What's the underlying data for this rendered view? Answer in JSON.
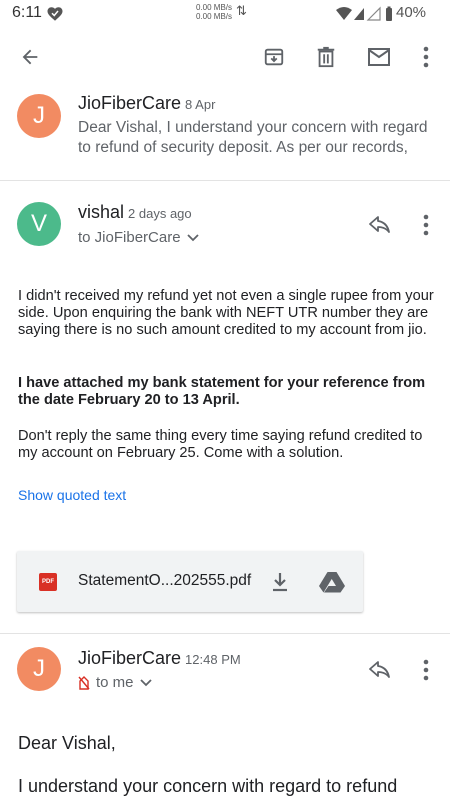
{
  "status_bar": {
    "time": "6:11",
    "speed_up": "0.00 MB/s",
    "speed_down": "0.00 MB/s",
    "battery": "40%"
  },
  "toolbar": {
    "icons": [
      "back-arrow-icon",
      "archive-icon",
      "delete-icon",
      "mark-unread-icon",
      "more-vert-icon"
    ]
  },
  "messages": [
    {
      "avatar_letter": "J",
      "avatar_color": "#f28b62",
      "sender": "JioFiberCare",
      "date": "8 Apr",
      "snippet": "Dear Vishal, I understand your concern with regard to refund of security deposit. As per our records,"
    },
    {
      "avatar_letter": "V",
      "avatar_color": "#4cba8b",
      "sender": "vishal",
      "date": "2 days ago",
      "to": "to JioFiberCare",
      "paragraphs": [
        "I didn't received my refund yet not even a single rupee from your side. Upon enquiring the bank with NEFT UTR number they are saying there is no such amount credited to my account from jio.",
        "I have attached my bank statement for your reference from the date February 20 to 13 April.",
        "Don't reply the same thing every time saying refund credited to my account on February 25. Come with a solution."
      ],
      "show_quoted": "Show quoted text",
      "attachment": {
        "badge": "PDF",
        "filename": "StatementO...202555.pdf"
      }
    },
    {
      "avatar_letter": "J",
      "avatar_color": "#f28b62",
      "sender": "JioFiberCare",
      "date": "12:48 PM",
      "to": "to me",
      "greeting": "Dear Vishal,",
      "body_start": "I understand your concern with regard to refund"
    }
  ],
  "colors": {
    "link": "#1a73e8",
    "secondary_text": "#5f6368"
  }
}
